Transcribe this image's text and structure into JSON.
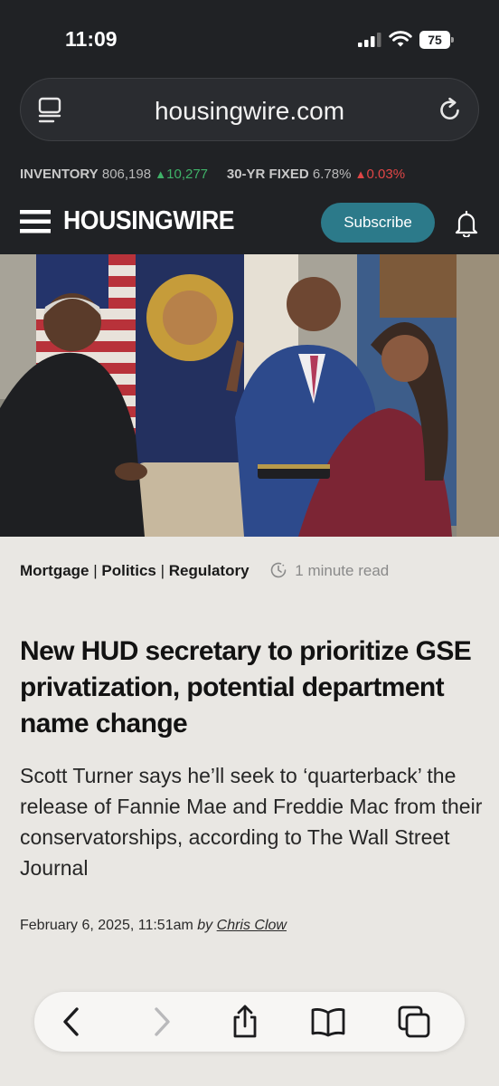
{
  "status_bar": {
    "time": "11:09",
    "battery": "75"
  },
  "browser": {
    "url": "housingwire.com"
  },
  "ticker": {
    "inventory_label": "INVENTORY",
    "inventory_value": "806,198",
    "inventory_change": "10,277",
    "rate_label": "30-YR FIXED",
    "rate_value": "6.78%",
    "rate_change": "0.03%",
    "colors": {
      "up": "#3fb268",
      "down": "#e04646"
    }
  },
  "site": {
    "logo": "HOUSINGWIRE",
    "subscribe_label": "Subscribe",
    "accent_color": "#2c7a8a"
  },
  "article": {
    "categories": [
      "Mortgage",
      "Politics",
      "Regulatory"
    ],
    "separator": "|",
    "read_time": "1 minute read",
    "headline": "New HUD secretary to prioritize GSE privatization, potential department name change",
    "dek": "Scott Turner says he’ll seek to ‘quarterback’ the release of Fannie Mae and Freddie Mac from their conservatorships, according to The Wall Street Journal",
    "date": "February 6, 2025, 11:51am",
    "by": "by",
    "author": "Chris Clow"
  },
  "icons": {
    "reader": "reader-icon",
    "reload": "reload-icon",
    "menu": "hamburger-menu-icon",
    "bell": "bell-icon",
    "clock": "clock-icon",
    "back": "chevron-left-icon",
    "forward": "chevron-right-icon",
    "share": "share-icon",
    "bookmarks": "book-icon",
    "tabs": "tabs-icon"
  }
}
